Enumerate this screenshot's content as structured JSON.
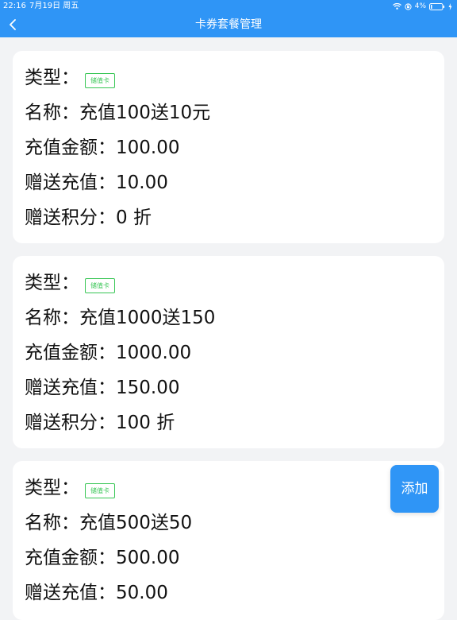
{
  "status_bar": {
    "time": "22:16",
    "date": "7月19日 周五",
    "battery": "4%"
  },
  "nav": {
    "title": "卡券套餐管理"
  },
  "packages": [
    {
      "type_label": "类型：",
      "type_tag": "储值卡",
      "name": "名称：充值100送10元",
      "amount": "充值金额：100.00",
      "bonus": "赠送充值：10.00",
      "points": "赠送积分：0 折"
    },
    {
      "type_label": "类型：",
      "type_tag": "储值卡",
      "name": "名称：充值1000送150",
      "amount": "充值金额：1000.00",
      "bonus": "赠送充值：150.00",
      "points": "赠送积分：100 折"
    },
    {
      "type_label": "类型：",
      "type_tag": "储值卡",
      "name": "名称：充值500送50",
      "amount": "充值金额：500.00",
      "bonus": "赠送充值：50.00"
    }
  ],
  "actions": {
    "add_label": "添加"
  },
  "colors": {
    "primary": "#2f95f6",
    "tag": "#37c654",
    "background": "#f2f3f5",
    "card": "#ffffff"
  },
  "icons": {
    "back": "chevron-left-icon",
    "wifi": "wifi-icon",
    "rotation_lock": "rotation-lock-icon",
    "battery": "battery-icon",
    "charging": "charging-bolt-icon"
  }
}
